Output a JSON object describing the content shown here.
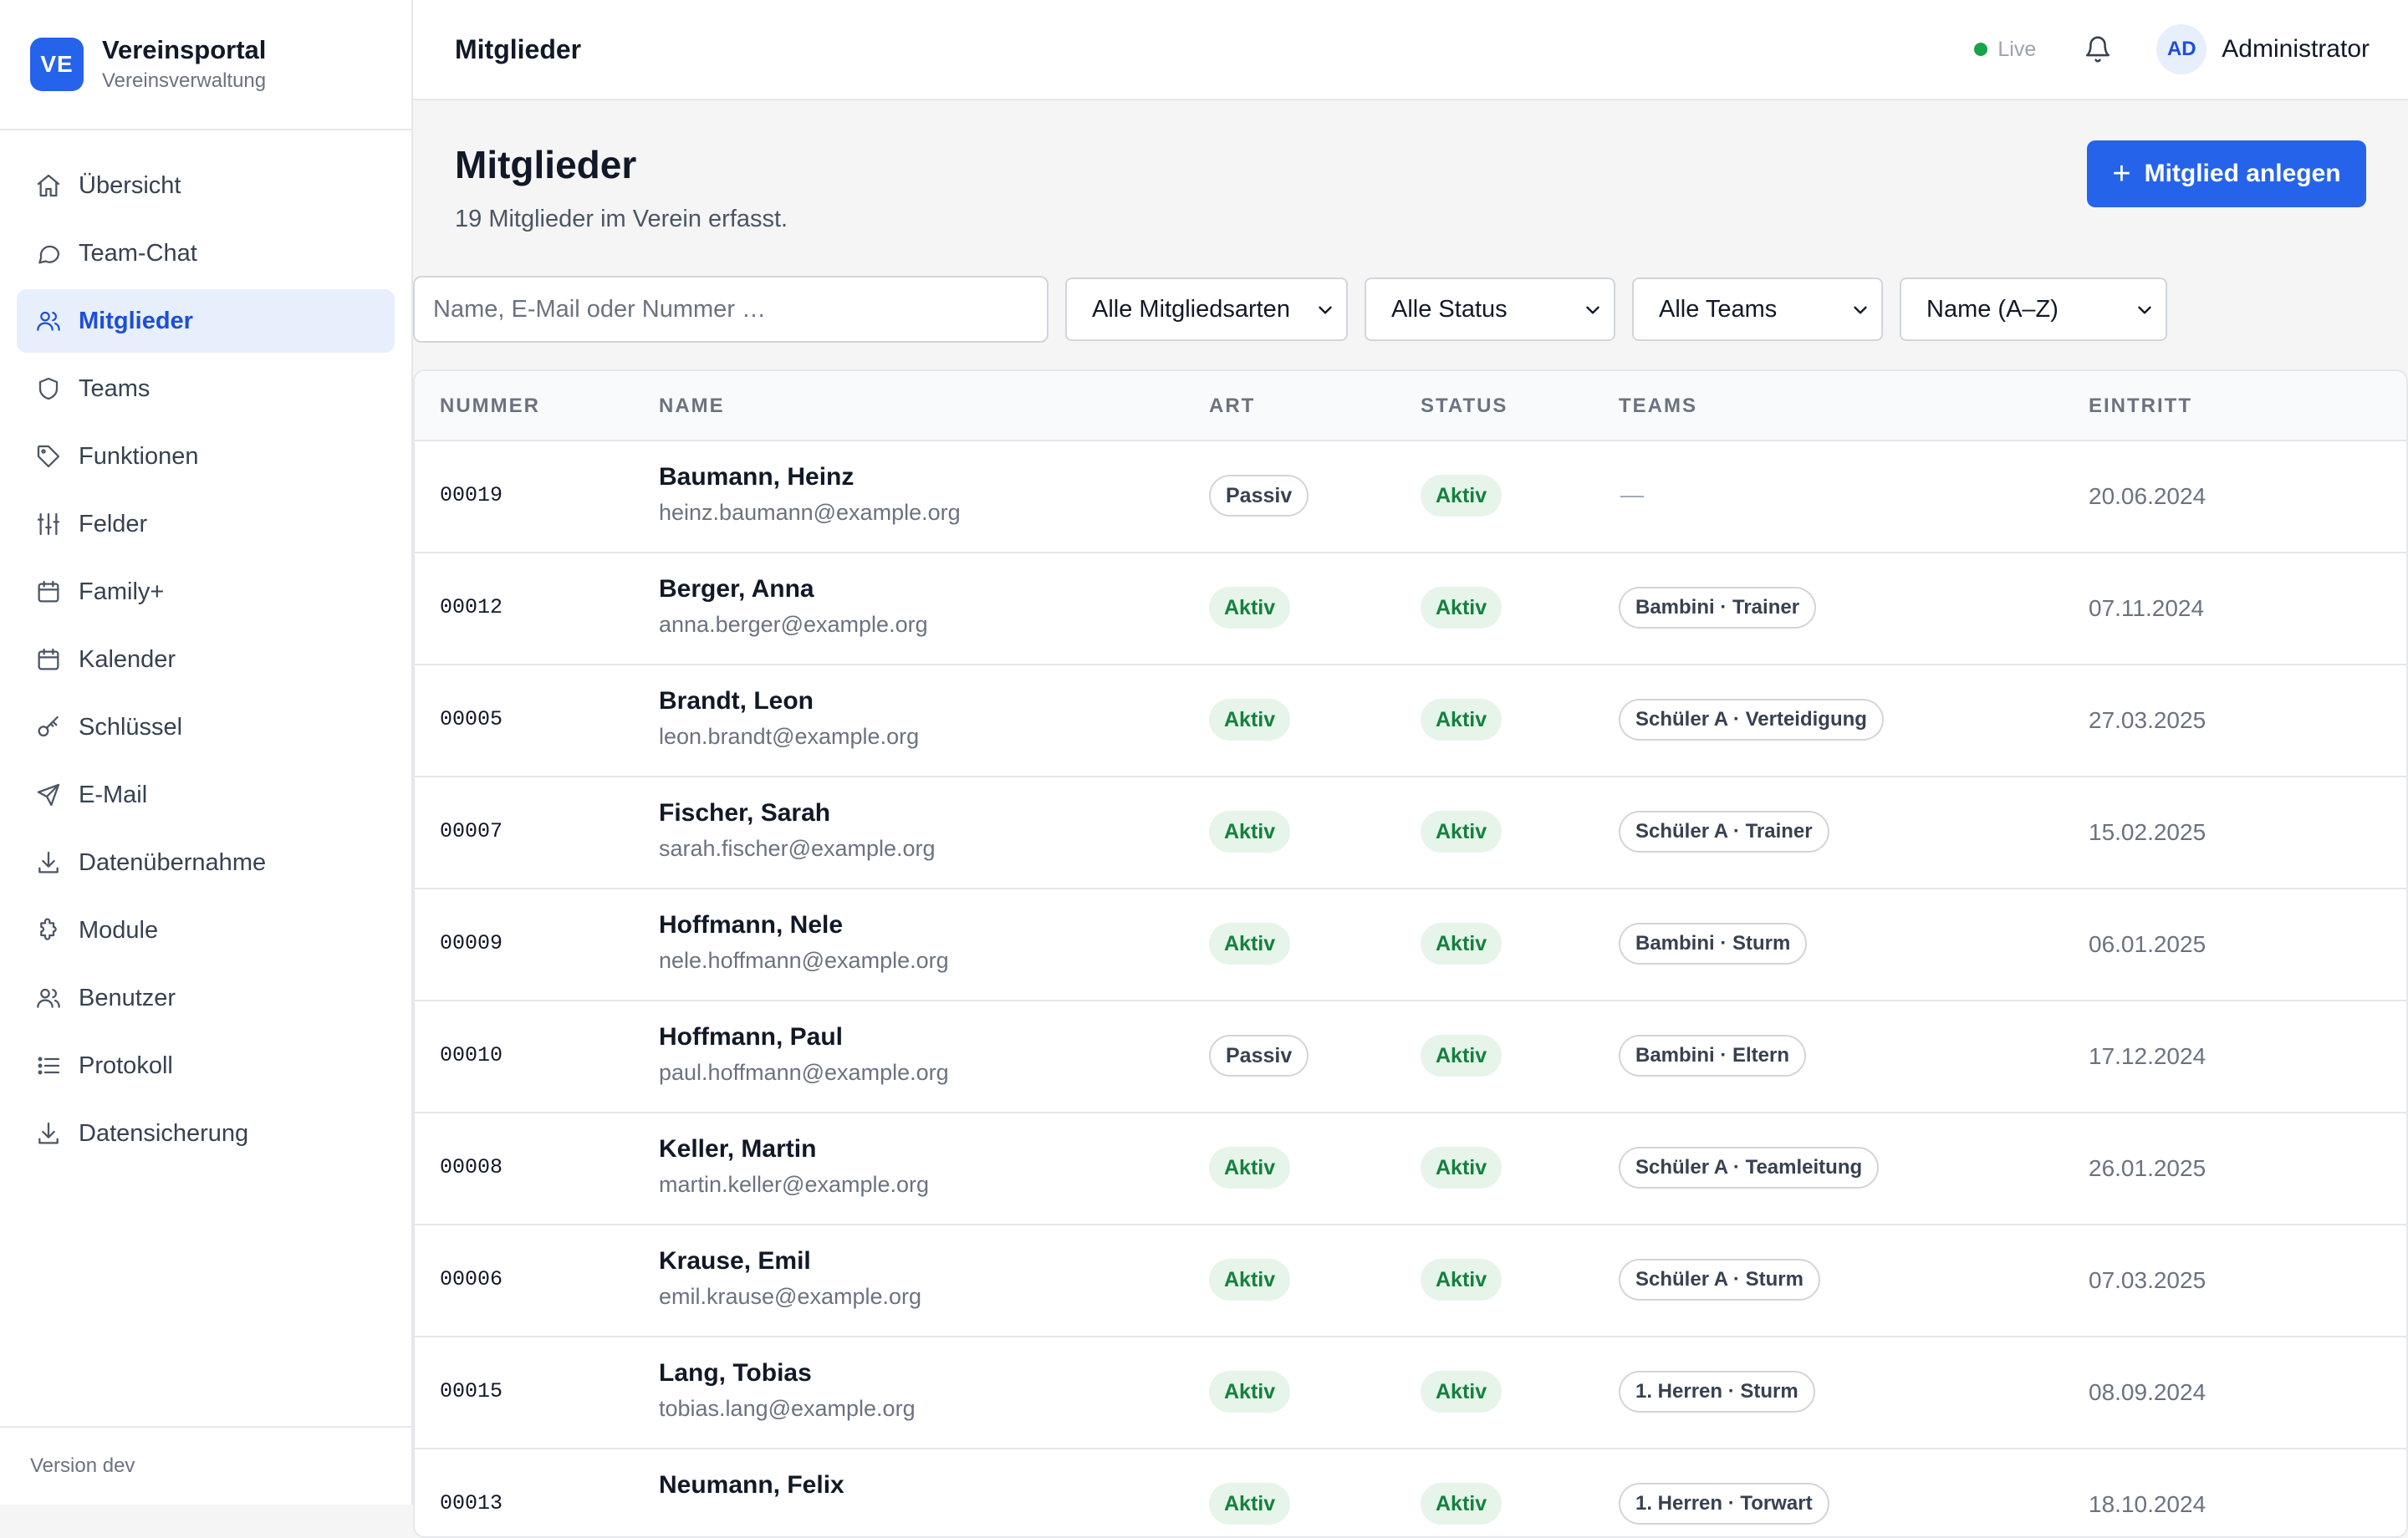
{
  "brand": {
    "logo": "VE",
    "name": "Vereinsportal",
    "subtitle": "Vereinsverwaltung"
  },
  "nav": [
    {
      "label": "Übersicht",
      "icon": "home-icon",
      "active": false
    },
    {
      "label": "Team-Chat",
      "icon": "chat-icon",
      "active": false
    },
    {
      "label": "Mitglieder",
      "icon": "users-icon",
      "active": true
    },
    {
      "label": "Teams",
      "icon": "shield-icon",
      "active": false
    },
    {
      "label": "Funktionen",
      "icon": "tag-icon",
      "active": false
    },
    {
      "label": "Felder",
      "icon": "sliders-icon",
      "active": false
    },
    {
      "label": "Family+",
      "icon": "calendar-icon",
      "active": false
    },
    {
      "label": "Kalender",
      "icon": "calendar-icon",
      "active": false
    },
    {
      "label": "Schlüssel",
      "icon": "key-icon",
      "active": false
    },
    {
      "label": "E-Mail",
      "icon": "send-icon",
      "active": false
    },
    {
      "label": "Datenübernahme",
      "icon": "download-icon",
      "active": false
    },
    {
      "label": "Module",
      "icon": "puzzle-icon",
      "active": false
    },
    {
      "label": "Benutzer",
      "icon": "users-icon",
      "active": false
    },
    {
      "label": "Protokoll",
      "icon": "list-icon",
      "active": false
    },
    {
      "label": "Datensicherung",
      "icon": "download-icon",
      "active": false
    }
  ],
  "footer": {
    "version": "Version dev"
  },
  "topbar": {
    "title": "Mitglieder",
    "live": "Live",
    "avatar": "AD",
    "user": "Administrator"
  },
  "page": {
    "title": "Mitglieder",
    "subtitle": "19 Mitglieder im Verein erfasst.",
    "add_button": "Mitglied anlegen",
    "search_placeholder": "Name, E-Mail oder Nummer …",
    "filters": [
      "Alle Mitgliedsarten",
      "Alle Status",
      "Alle Teams",
      "Name (A–Z)"
    ]
  },
  "table": {
    "headers": [
      "NUMMER",
      "NAME",
      "ART",
      "STATUS",
      "TEAMS",
      "EINTRITT"
    ],
    "rows": [
      {
        "nummer": "00019",
        "name": "Baumann, Heinz",
        "email": "heinz.baumann@example.org",
        "art": "Passiv",
        "status": "Aktiv",
        "teams": "—",
        "eintritt": "20.06.2024"
      },
      {
        "nummer": "00012",
        "name": "Berger, Anna",
        "email": "anna.berger@example.org",
        "art": "Aktiv",
        "status": "Aktiv",
        "teams": "Bambini · Trainer",
        "eintritt": "07.11.2024"
      },
      {
        "nummer": "00005",
        "name": "Brandt, Leon",
        "email": "leon.brandt@example.org",
        "art": "Aktiv",
        "status": "Aktiv",
        "teams": "Schüler A · Verteidigung",
        "eintritt": "27.03.2025"
      },
      {
        "nummer": "00007",
        "name": "Fischer, Sarah",
        "email": "sarah.fischer@example.org",
        "art": "Aktiv",
        "status": "Aktiv",
        "teams": "Schüler A · Trainer",
        "eintritt": "15.02.2025"
      },
      {
        "nummer": "00009",
        "name": "Hoffmann, Nele",
        "email": "nele.hoffmann@example.org",
        "art": "Aktiv",
        "status": "Aktiv",
        "teams": "Bambini · Sturm",
        "eintritt": "06.01.2025"
      },
      {
        "nummer": "00010",
        "name": "Hoffmann, Paul",
        "email": "paul.hoffmann@example.org",
        "art": "Passiv",
        "status": "Aktiv",
        "teams": "Bambini · Eltern",
        "eintritt": "17.12.2024"
      },
      {
        "nummer": "00008",
        "name": "Keller, Martin",
        "email": "martin.keller@example.org",
        "art": "Aktiv",
        "status": "Aktiv",
        "teams": "Schüler A · Teamleitung",
        "eintritt": "26.01.2025"
      },
      {
        "nummer": "00006",
        "name": "Krause, Emil",
        "email": "emil.krause@example.org",
        "art": "Aktiv",
        "status": "Aktiv",
        "teams": "Schüler A · Sturm",
        "eintritt": "07.03.2025"
      },
      {
        "nummer": "00015",
        "name": "Lang, Tobias",
        "email": "tobias.lang@example.org",
        "art": "Aktiv",
        "status": "Aktiv",
        "teams": "1. Herren · Sturm",
        "eintritt": "08.09.2024"
      },
      {
        "nummer": "00013",
        "name": "Neumann, Felix",
        "email": "",
        "art": "Aktiv",
        "status": "Aktiv",
        "teams": "1. Herren · Torwart",
        "eintritt": "18.10.2024"
      }
    ]
  }
}
